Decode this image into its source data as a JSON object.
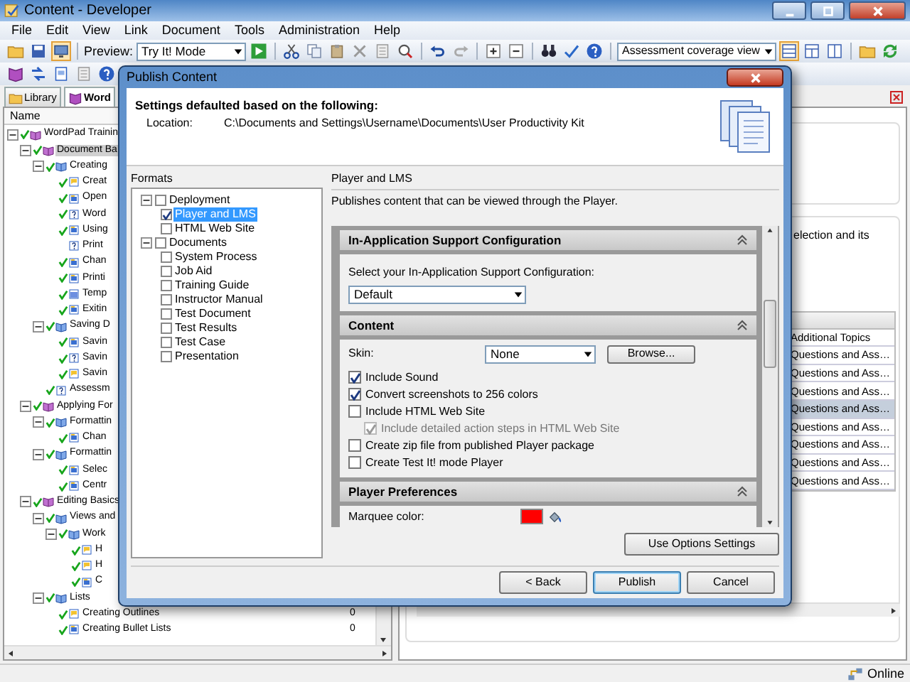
{
  "window": {
    "title": "Content - Developer"
  },
  "menu": [
    {
      "label": "File"
    },
    {
      "label": "Edit"
    },
    {
      "label": "View"
    },
    {
      "label": "Link"
    },
    {
      "label": "Document"
    },
    {
      "label": "Tools"
    },
    {
      "label": "Administration"
    },
    {
      "label": "Help"
    }
  ],
  "toolbar": {
    "preview_label": "Preview:",
    "preview_mode": "Try It! Mode",
    "view_mode": "Assessment coverage view"
  },
  "tabs": [
    {
      "label": "Library",
      "selected": false
    },
    {
      "label": "Word",
      "selected": true
    }
  ],
  "outline": {
    "column": "Name",
    "items": [
      {
        "label": "WordPad Trainin",
        "kind": "module",
        "checked": true,
        "selected": false,
        "expanded": true,
        "children": [
          {
            "label": "Document Ba",
            "kind": "module",
            "checked": true,
            "selected": true,
            "expanded": true,
            "children": [
              {
                "label": "Creating",
                "kind": "section",
                "checked": true,
                "selected": false,
                "expanded": true,
                "children": [
                  {
                    "label": "Creat",
                    "kind": "topic",
                    "checked": true,
                    "selected": false
                  },
                  {
                    "label": "Open",
                    "kind": "screen",
                    "checked": true,
                    "selected": false
                  },
                  {
                    "label": "Word",
                    "kind": "question",
                    "checked": true,
                    "selected": false
                  },
                  {
                    "label": "Using",
                    "kind": "screen",
                    "checked": true,
                    "selected": false
                  },
                  {
                    "label": "Print",
                    "kind": "question",
                    "checked": false,
                    "selected": false
                  },
                  {
                    "label": "Chan",
                    "kind": "screen",
                    "checked": true,
                    "selected": false
                  },
                  {
                    "label": "Printi",
                    "kind": "screen",
                    "checked": true,
                    "selected": false
                  },
                  {
                    "label": "Temp",
                    "kind": "page",
                    "checked": true,
                    "selected": false
                  },
                  {
                    "label": "Exitin",
                    "kind": "screen",
                    "checked": true,
                    "selected": false
                  }
                ]
              },
              {
                "label": "Saving D",
                "kind": "section",
                "checked": true,
                "selected": false,
                "expanded": true,
                "children": [
                  {
                    "label": "Savin",
                    "kind": "screen",
                    "checked": true,
                    "selected": false
                  },
                  {
                    "label": "Savin",
                    "kind": "question",
                    "checked": true,
                    "selected": false
                  },
                  {
                    "label": "Savin",
                    "kind": "topic",
                    "checked": true,
                    "selected": false
                  }
                ]
              },
              {
                "label": "Assessm",
                "kind": "question",
                "checked": true,
                "selected": false
              }
            ]
          },
          {
            "label": "Applying For",
            "kind": "module",
            "checked": true,
            "selected": false,
            "expanded": true,
            "children": [
              {
                "label": "Formattin",
                "kind": "section",
                "checked": true,
                "selected": false,
                "expanded": true,
                "children": [
                  {
                    "label": "Chan",
                    "kind": "screen",
                    "checked": true,
                    "selected": false
                  }
                ]
              },
              {
                "label": "Formattin",
                "kind": "section",
                "checked": true,
                "selected": false,
                "expanded": true,
                "children": [
                  {
                    "label": "Selec",
                    "kind": "screen",
                    "checked": true,
                    "selected": false
                  },
                  {
                    "label": "Centr",
                    "kind": "screen",
                    "checked": true,
                    "selected": false
                  }
                ]
              }
            ]
          },
          {
            "label": "Editing Basics",
            "kind": "module",
            "checked": true,
            "selected": false,
            "expanded": true,
            "children": [
              {
                "label": "Views and",
                "kind": "section",
                "checked": true,
                "selected": false,
                "expanded": true,
                "children": [
                  {
                    "label": "Work",
                    "kind": "section",
                    "checked": true,
                    "selected": false,
                    "expanded": true,
                    "children": [
                      {
                        "label": "H",
                        "kind": "topic",
                        "checked": true,
                        "selected": false
                      },
                      {
                        "label": "H",
                        "kind": "topic",
                        "checked": true,
                        "selected": false
                      },
                      {
                        "label": "C",
                        "kind": "screen",
                        "checked": true,
                        "selected": false
                      }
                    ]
                  }
                ]
              },
              {
                "label": "Lists",
                "kind": "section",
                "checked": true,
                "selected": false,
                "expanded": true,
                "children": [
                  {
                    "label": "Creating Outlines",
                    "kind": "topic",
                    "checked": true,
                    "selected": false,
                    "count": "0"
                  },
                  {
                    "label": "Creating Bullet Lists",
                    "kind": "screen",
                    "checked": true,
                    "selected": false,
                    "count": "0"
                  }
                ]
              }
            ]
          }
        ]
      }
    ]
  },
  "details": {
    "description": "election and its",
    "column": "Additional Topics",
    "rows": [
      {
        "text": "Questions and Ass…",
        "selected": false
      },
      {
        "text": "Questions and Ass…",
        "selected": false
      },
      {
        "text": "Questions and Ass…",
        "selected": false
      },
      {
        "text": "Questions and Ass…",
        "selected": true
      },
      {
        "text": "Questions and Ass…",
        "selected": false
      },
      {
        "text": "Questions and Ass…",
        "selected": false
      },
      {
        "text": "Questions and Ass…",
        "selected": false
      },
      {
        "text": "Questions and Ass…",
        "selected": false
      }
    ]
  },
  "status_bar": {
    "status": "Online"
  },
  "dialog": {
    "title": "Publish Content",
    "heading": "Settings defaulted based on the following:",
    "location_label": "Location:",
    "location": "C:\\Documents and Settings\\Username\\Documents\\User Productivity Kit",
    "formats_label": "Formats",
    "formats": [
      {
        "label": "Deployment",
        "checked": false,
        "selected": false,
        "expanded": true,
        "children": [
          {
            "label": "Player and LMS",
            "checked": true,
            "selected": true
          },
          {
            "label": "HTML Web Site",
            "checked": false,
            "selected": false
          }
        ]
      },
      {
        "label": "Documents",
        "checked": false,
        "selected": false,
        "expanded": true,
        "children": [
          {
            "label": "System Process",
            "checked": false,
            "selected": false
          },
          {
            "label": "Job Aid",
            "checked": false,
            "selected": false
          },
          {
            "label": "Training Guide",
            "checked": false,
            "selected": false
          },
          {
            "label": "Instructor Manual",
            "checked": false,
            "selected": false
          },
          {
            "label": "Test Document",
            "checked": false,
            "selected": false
          },
          {
            "label": "Test Results",
            "checked": false,
            "selected": false
          },
          {
            "label": "Test Case",
            "checked": false,
            "selected": false
          },
          {
            "label": "Presentation",
            "checked": false,
            "selected": false
          }
        ]
      }
    ],
    "panel_title": "Player and LMS",
    "panel_description": "Publishes content that can be viewed through the Player.",
    "sections": [
      {
        "kind": "config",
        "title": "In-Application Support Configuration",
        "expanded": true,
        "label": "Select your In-Application Support Configuration:",
        "value": "Default"
      },
      {
        "kind": "content",
        "title": "Content",
        "expanded": true,
        "skin_label": "Skin:",
        "skin_value": "None",
        "browse_button": "Browse...",
        "options": [
          {
            "label": "Include Sound",
            "checked": true,
            "disabled": false
          },
          {
            "label": "Convert screenshots to 256 colors",
            "checked": true,
            "disabled": false
          },
          {
            "label": "Include HTML Web Site",
            "checked": false,
            "disabled": false,
            "children": [
              {
                "label": "Include detailed action steps in HTML Web Site",
                "checked": true,
                "disabled": true
              }
            ]
          },
          {
            "label": "Create zip file from published Player package",
            "checked": false,
            "disabled": false
          },
          {
            "label": "Create Test It! mode Player",
            "checked": false,
            "disabled": false
          }
        ]
      },
      {
        "kind": "preferences",
        "title": "Player Preferences",
        "expanded": true,
        "fields": [
          {
            "label": "Marquee color:",
            "color": "#ff0000"
          }
        ]
      }
    ],
    "options_button": "Use Options Settings",
    "buttons": [
      {
        "label": "< Back",
        "default": false
      },
      {
        "label": "Publish",
        "default": true
      },
      {
        "label": "Cancel",
        "default": false
      }
    ]
  }
}
